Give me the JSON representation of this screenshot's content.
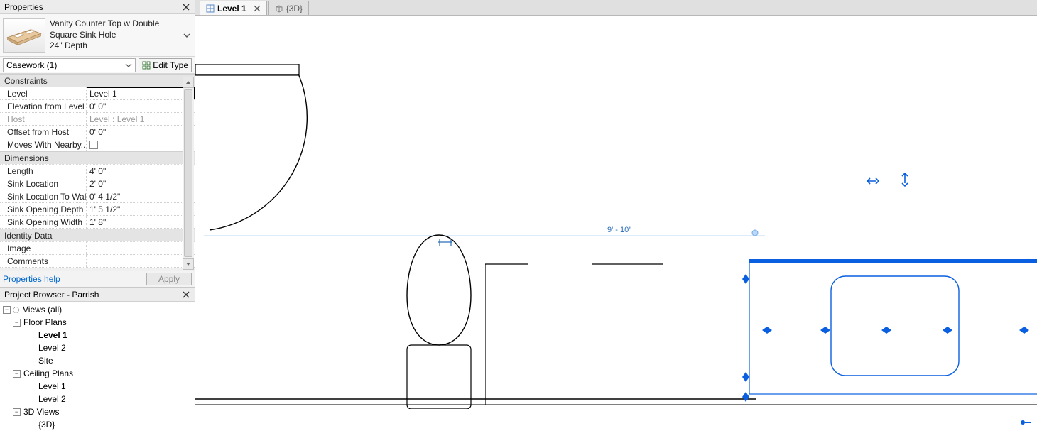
{
  "domain": "Computer-Use",
  "panels": {
    "properties_title": "Properties",
    "browser_title": "Project Browser - Parrish"
  },
  "type": {
    "name_line1": "Vanity Counter Top w Double",
    "name_line2": "Square Sink Hole",
    "name_line3": "24\" Depth",
    "category_label": "Casework (1)",
    "edit_type_label": "Edit Type"
  },
  "prop_groups": {
    "constraints": "Constraints",
    "dimensions": "Dimensions",
    "identity": "Identity Data"
  },
  "props": {
    "level_k": "Level",
    "level_v": "Level 1",
    "elev_k": "Elevation from Level",
    "elev_v": "0'  0\"",
    "host_k": "Host",
    "host_v": "Level : Level 1",
    "offset_k": "Offset from Host",
    "offset_v": "0'  0\"",
    "moves_k": "Moves With Nearby...",
    "len_k": "Length",
    "len_v": "4'  0\"",
    "sloc_k": "Sink Location",
    "sloc_v": "2'  0\"",
    "slw_k": "Sink Location To Wall",
    "slw_v": "0'  4 1/2\"",
    "sod_k": "Sink Opening Depth",
    "sod_v": "1'  5 1/2\"",
    "sow_k": "Sink Opening Width",
    "sow_v": "1'  8\"",
    "img_k": "Image",
    "com_k": "Comments"
  },
  "footer": {
    "help": "Properties help",
    "apply": "Apply"
  },
  "browser": {
    "views": "Views (all)",
    "floor": "Floor Plans",
    "l1": "Level 1",
    "l2": "Level 2",
    "site": "Site",
    "ceil": "Ceiling Plans",
    "cl1": "Level 1",
    "cl2": "Level 2",
    "d3": "3D Views",
    "d3item": "{3D}"
  },
  "tabs": {
    "t1": "Level 1",
    "t2": "{3D}"
  },
  "canvas": {
    "dim": "9' - 10\""
  }
}
